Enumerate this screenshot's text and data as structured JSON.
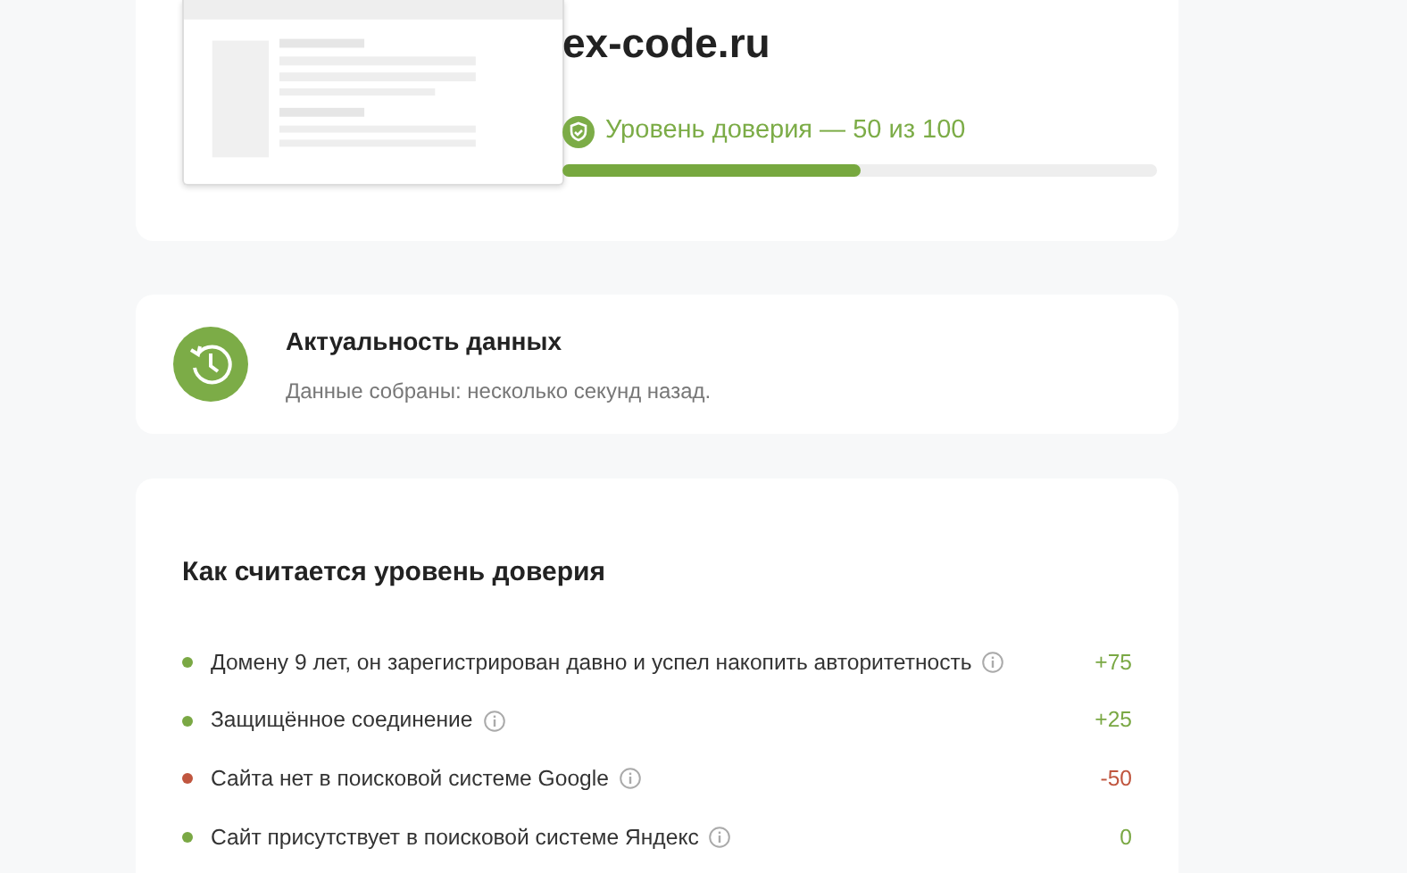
{
  "site": {
    "domain": "ex-code.ru",
    "trust_label": "Уровень доверия — 50 из 100",
    "level": 0.5
  },
  "freshness": {
    "title": "Актуальность данных",
    "text": "Данные собраны: несколько секунд назад."
  },
  "breakdown": {
    "title": "Как считается уровень доверия",
    "items": [
      {
        "text": "Домену 9 лет, он зарегистрирован давно и успел накопить авторитетность",
        "score": "+75",
        "color": "#7aa844"
      },
      {
        "text": "Защищённое соединение",
        "score": "+25",
        "color": "#7aa844"
      },
      {
        "text": "Сайта нет в поисковой системе Google",
        "score": "-50",
        "color": "#c0563f"
      },
      {
        "text": "Сайт присутствует в поисковой системе Яндекс",
        "score": "0",
        "color": "#7aa844"
      }
    ]
  }
}
